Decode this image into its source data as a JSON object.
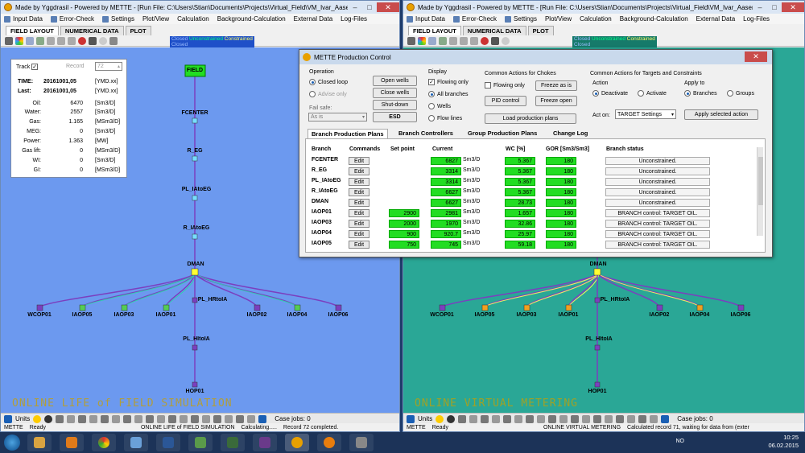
{
  "left_window": {
    "title": "Made by Yggdrasil   -   Powered by METTE - [Run File: C:\\Users\\Stian\\Documents\\Projects\\Virtual_Field\\VM_Ivar_Aasen\\",
    "menu": [
      "Input Data",
      "Error-Check",
      "Settings",
      "Plot/View",
      "Calculation",
      "Background-Calculation",
      "External Data",
      "Log-Files"
    ],
    "tabs": [
      "FIELD LAYOUT",
      "NUMERICAL DATA",
      "PLOT"
    ],
    "legend": [
      "Closed",
      "Unconstrained",
      "Constrained"
    ],
    "info": {
      "track": "Track",
      "record_label": "Record",
      "record_value": "72",
      "time_label": "TIME:",
      "time_value": "20161001,05",
      "time_unit": "[YMD.xx]",
      "last_label": "Last:",
      "last_value": "20161001,05",
      "last_unit": "[YMD.xx]",
      "rows": [
        {
          "k": "Oil:",
          "v": "6470",
          "u": "[Sm3/D]"
        },
        {
          "k": "Water:",
          "v": "2557",
          "u": "[Sm3/D]"
        },
        {
          "k": "Gas:",
          "v": "1.165",
          "u": "[MSm3/D]"
        },
        {
          "k": "MEG:",
          "v": "0",
          "u": "[Sm3/D]"
        },
        {
          "k": "Power:",
          "v": "1.363",
          "u": "[MW]"
        },
        {
          "k": "Gas lift:",
          "v": "0",
          "u": "[MSm3/D]"
        },
        {
          "k": "WI:",
          "v": "0",
          "u": "[Sm3/D]"
        },
        {
          "k": "GI:",
          "v": "0",
          "u": "[MSm3/D]"
        }
      ]
    },
    "nodes": {
      "field": "FIELD",
      "fcenter": "FCENTER",
      "r_eg": "R_EG",
      "pl_iatoeg": "PL_IAtoEG",
      "r_iatoeg": "R_IAtoEG",
      "dman": "DMAN",
      "pl_hrtoia": "PL_HRtoIA",
      "pl_hitoia": "PL_HItoIA",
      "hop01": "HOP01",
      "wells": [
        "WCOP01",
        "IAOP05",
        "IAOP03",
        "IAOP01",
        "IAOP02",
        "IAOP04",
        "IAOP06"
      ]
    },
    "banner": "ONLINE LIFE of FIELD SIMULATION",
    "units": "Units",
    "case_jobs": "Case jobs: 0",
    "status": [
      "METTE",
      "Ready",
      "ONLINE LIFE of FIELD SIMULATION",
      "Calculating.....",
      "Record 72 completed."
    ]
  },
  "right_window": {
    "title": "Made by Yggdrasil   -   Powered by METTE - [Run File: C:\\Users\\Stian\\Documents\\Projects\\Virtual_Field\\VM_Ivar_Aasen\\",
    "menu": [
      "Input Data",
      "Error-Check",
      "Settings",
      "Plot/View",
      "Calculation",
      "Background-Calculation",
      "External Data",
      "Log-Files"
    ],
    "tabs": [
      "FIELD LAYOUT",
      "NUMERICAL DATA",
      "PLOT"
    ],
    "legend": [
      "Closed",
      "Unconstrained",
      "Constrained"
    ],
    "nodes": {
      "dman": "DMAN",
      "pl_hrtoia": "PL_HRtoIA",
      "pl_hitoia": "PL_HItoIA",
      "hop01": "HOP01",
      "wells": [
        "WCOP01",
        "IAOP05",
        "IAOP03",
        "IAOP01",
        "IAOP02",
        "IAOP04",
        "IAOP06"
      ]
    },
    "banner": "ONLINE VIRTUAL METERING",
    "units": "Units",
    "case_jobs": "Case jobs: 0",
    "status": [
      "METTE",
      "Ready",
      "ONLINE VIRTUAL METERING",
      "Calculated record 71, waiting for data from (exter"
    ]
  },
  "dialog": {
    "title": "METTE Production Control",
    "operation": {
      "label": "Operation",
      "closed": "Closed loop",
      "advise": "Advise only",
      "failsafe": "Fail safe:",
      "failsafe_value": "As is",
      "buttons": [
        "Open wells",
        "Close wells",
        "Shut-down",
        "ESD"
      ]
    },
    "display": {
      "label": "Display",
      "flowing": "Flowing only",
      "all": "All branches",
      "wells": "Wells",
      "flow": "Flow lines"
    },
    "chokes": {
      "label": "Common Actions for Chokes",
      "flowing": "Flowing only",
      "pid": "PID control",
      "freeze_as_is": "Freeze as is",
      "freeze_open": "Freeze open",
      "load": "Load production plans"
    },
    "targets": {
      "label": "Common Actions for Targets and Constraints",
      "action": "Action",
      "deactivate": "Deactivate",
      "activate": "Activate",
      "apply_to": "Apply to",
      "branches": "Branches",
      "groups": "Groups",
      "act_on": "Act on:",
      "act_on_value": "TARGET Settings",
      "apply_btn": "Apply selected action"
    },
    "tabs": [
      "Branch Production Plans",
      "Branch Controllers",
      "Group Production Plans",
      "Change Log"
    ],
    "headers": [
      "Branch",
      "Commands",
      "Set point",
      "Current",
      "WC [%]",
      "GOR [Sm3/Sm3]",
      "Branch status"
    ],
    "edit": "Edit",
    "unit": "Sm3/D",
    "rows": [
      {
        "branch": "FCENTER",
        "set": "",
        "cur": "6827",
        "wc": "5.367",
        "gor": "180",
        "status": "Unconstrained."
      },
      {
        "branch": "R_EG",
        "set": "",
        "cur": "3314",
        "wc": "5.367",
        "gor": "180",
        "status": "Unconstrained."
      },
      {
        "branch": "PL_IAtoEG",
        "set": "",
        "cur": "3314",
        "wc": "5.367",
        "gor": "180",
        "status": "Unconstrained."
      },
      {
        "branch": "R_IAtoEG",
        "set": "",
        "cur": "6627",
        "wc": "5.367",
        "gor": "180",
        "status": "Unconstrained."
      },
      {
        "branch": "DMAN",
        "set": "",
        "cur": "6627",
        "wc": "28.73",
        "gor": "180",
        "status": "Unconstrained."
      },
      {
        "branch": "IAOP01",
        "set": "2900",
        "cur": "2981",
        "wc": "1.657",
        "gor": "180",
        "status": "BRANCH control: TARGET OIL."
      },
      {
        "branch": "IAOP03",
        "set": "2000",
        "cur": "1970",
        "wc": "32.86",
        "gor": "180",
        "status": "BRANCH control: TARGET OIL."
      },
      {
        "branch": "IAOP04",
        "set": "900",
        "cur": "920.7",
        "wc": "25.97",
        "gor": "180",
        "status": "BRANCH control: TARGET OIL."
      },
      {
        "branch": "IAOP05",
        "set": "750",
        "cur": "745",
        "wc": "59.18",
        "gor": "180",
        "status": "BRANCH control: TARGET OIL."
      }
    ]
  },
  "taskbar": {
    "lang": "NO",
    "time": "10:25",
    "date": "06.02.2015"
  }
}
